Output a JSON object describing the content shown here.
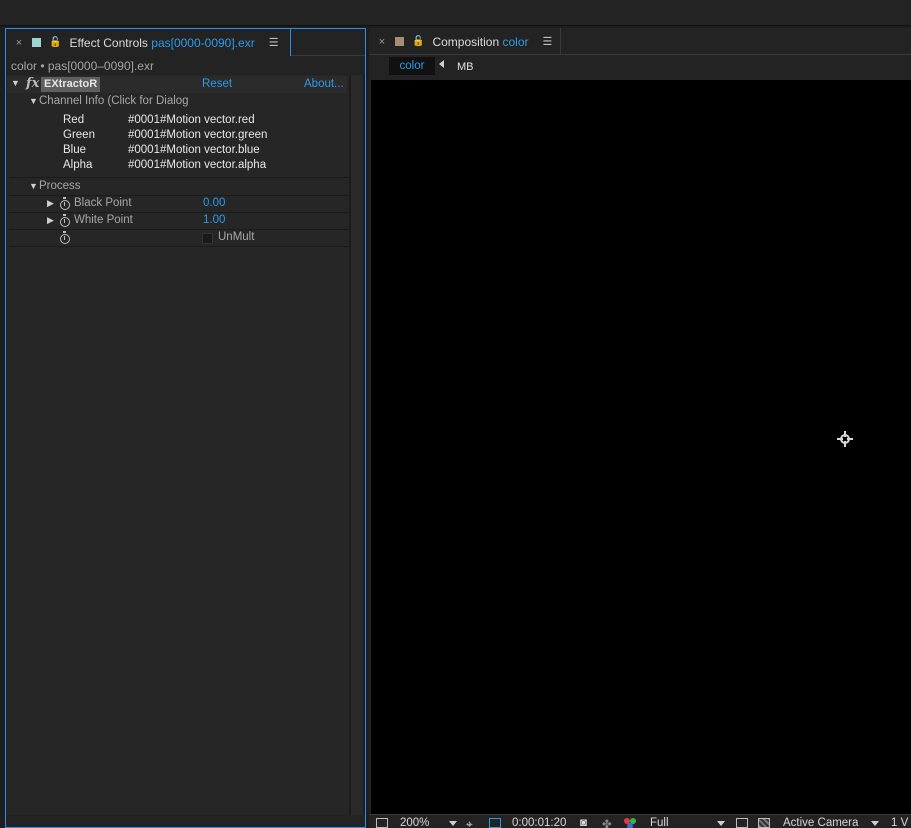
{
  "effect_controls": {
    "close_glyph": "×",
    "swatch_color": "#9fd3cf",
    "lock_glyph": "🔓",
    "title": "Effect Controls",
    "layer_name": "pas[0000-0090].exr",
    "menu_glyph": "☰",
    "subheader": "color • pas[0000–0090].exr",
    "effect": {
      "fx_label": "fx",
      "name": "EXtractoR",
      "reset": "Reset",
      "about": "About..."
    },
    "channel_info": {
      "label": "Channel Info (Click for Dialog",
      "channels": [
        {
          "name": "Red",
          "value": "#0001#Motion vector.red"
        },
        {
          "name": "Green",
          "value": "#0001#Motion vector.green"
        },
        {
          "name": "Blue",
          "value": "#0001#Motion vector.blue"
        },
        {
          "name": "Alpha",
          "value": "#0001#Motion vector.alpha"
        }
      ]
    },
    "process": {
      "label": "Process",
      "black_point_label": "Black Point",
      "black_point_value": "0.00",
      "white_point_label": "White Point",
      "white_point_value": "1.00",
      "unmult_label": "UnMult",
      "unmult_checked": false
    }
  },
  "composition": {
    "close_glyph": "×",
    "swatch_color": "#a58e74",
    "lock_glyph": "🔓",
    "title": "Composition",
    "comp_name": "color",
    "menu_glyph": "☰",
    "flowchart": {
      "active": "color",
      "previous": "MB"
    },
    "bottom_bar": {
      "zoom": "200%",
      "timecode": "0:00:01:20",
      "resolution": "Full",
      "camera": "Active Camera",
      "views": "1 V"
    }
  },
  "colors": {
    "accent_blue": "#2d9be9",
    "panel_focus_border": "#2d8ceb",
    "viewer_bg": "#000000"
  }
}
